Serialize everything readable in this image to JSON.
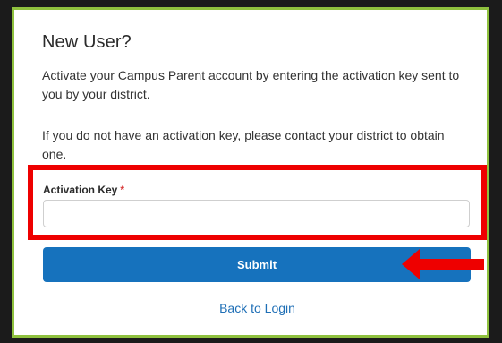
{
  "form": {
    "title": "New User?",
    "intro": "Activate your Campus Parent account by entering the activation key sent to you by your district.",
    "help": "If you do not have an activation key, please contact your district to obtain one.",
    "activation_key_label": "Activation Key",
    "required_marker": "*",
    "activation_key_value": "",
    "activation_key_placeholder": "",
    "submit_label": "Submit",
    "back_link_label": "Back to Login"
  },
  "colors": {
    "frame": "#1b1b1b",
    "card_border": "#8fc13e",
    "highlight": "#ee0000",
    "button": "#1672bd",
    "link": "#1f6fb6",
    "required": "#d83a3a"
  }
}
